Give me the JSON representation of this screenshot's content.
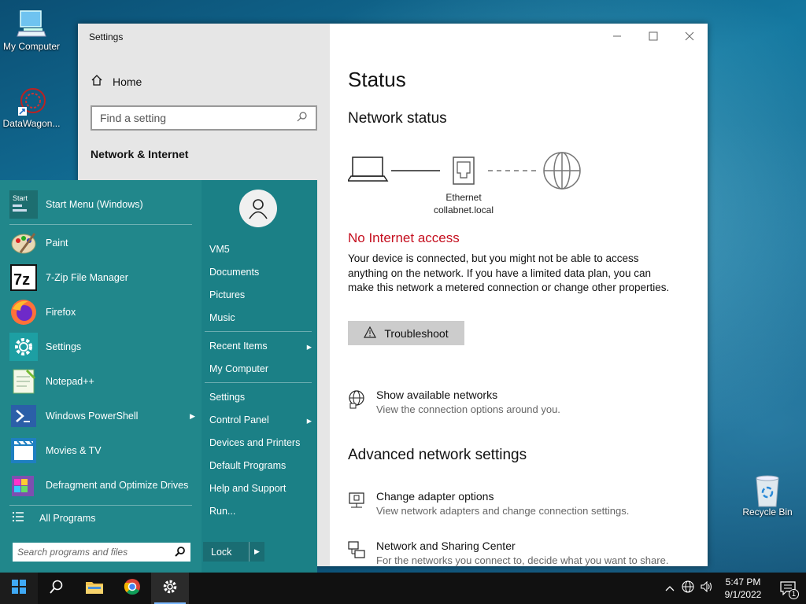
{
  "desktop": {
    "icons": [
      {
        "label": "My Computer"
      },
      {
        "label": "DataWagon..."
      },
      {
        "label": "Recycle Bin"
      }
    ]
  },
  "settings": {
    "window_title": "Settings",
    "home_label": "Home",
    "search_placeholder": "Find a setting",
    "section": "Network & Internet",
    "page_title": "Status",
    "network_status_heading": "Network status",
    "adapter_name": "Ethernet",
    "adapter_domain": "collabnet.local",
    "no_internet": "No Internet access",
    "description": "Your device is connected, but you might not be able to access anything on the network. If you have a limited data plan, you can make this network a metered connection or change other properties.",
    "troubleshoot_label": "Troubleshoot",
    "show_networks_title": "Show available networks",
    "show_networks_sub": "View the connection options around you.",
    "advanced_heading": "Advanced network settings",
    "change_adapter_title": "Change adapter options",
    "change_adapter_sub": "View network adapters and change connection settings.",
    "sharing_center_title": "Network and Sharing Center",
    "sharing_center_sub": "For the networks you connect to, decide what you want to share.",
    "error_color": "#c50f1f"
  },
  "start_menu": {
    "programs": [
      {
        "label": "Start Menu (Windows)",
        "icon": "start-menu-icon"
      },
      {
        "label": "Paint",
        "icon": "paint-icon"
      },
      {
        "label": "7-Zip File Manager",
        "icon": "7zip-icon"
      },
      {
        "label": "Firefox",
        "icon": "firefox-icon"
      },
      {
        "label": "Settings",
        "icon": "gear-icon"
      },
      {
        "label": "Notepad++",
        "icon": "notepad-icon"
      },
      {
        "label": "Windows PowerShell",
        "icon": "powershell-icon"
      },
      {
        "label": "Movies & TV",
        "icon": "movies-icon"
      },
      {
        "label": "Defragment and Optimize Drives",
        "icon": "defrag-icon"
      }
    ],
    "all_programs": "All Programs",
    "search_placeholder": "Search programs and files",
    "right_items": [
      {
        "label": "VM5"
      },
      {
        "label": "Documents"
      },
      {
        "label": "Pictures"
      },
      {
        "label": "Music"
      },
      {
        "label": "Recent Items",
        "arrow": "▸"
      },
      {
        "label": "My Computer"
      },
      {
        "label": "Settings"
      },
      {
        "label": "Control Panel",
        "arrow": "▸"
      },
      {
        "label": "Devices and Printers"
      },
      {
        "label": "Default Programs"
      },
      {
        "label": "Help and Support"
      },
      {
        "label": "Run..."
      }
    ],
    "lock_label": "Lock",
    "accent": "#21878b"
  },
  "taskbar": {
    "time": "5:47 PM",
    "date": "9/1/2022",
    "notification_count": "1"
  }
}
